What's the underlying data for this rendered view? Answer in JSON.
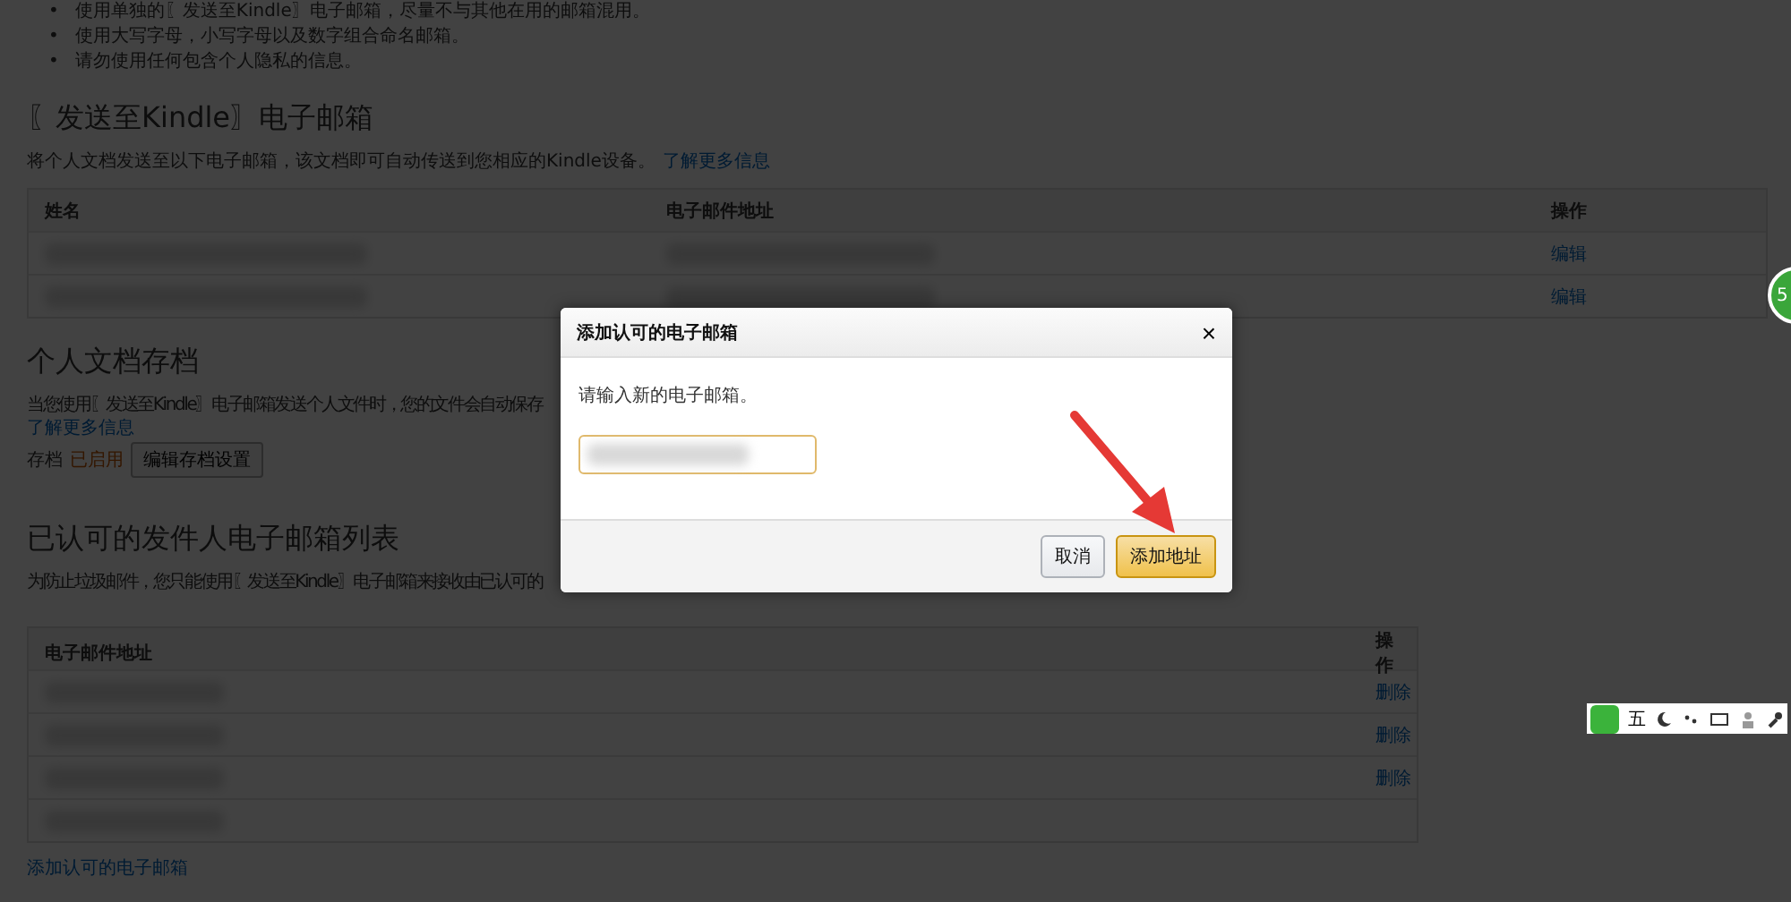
{
  "guideline_marker": "•",
  "guidelines": [
    "使用单独的〖发送至Kindle〗电子邮箱，尽量不与其他在用的邮箱混用。",
    "使用大写字母，小写字母以及数字组合命名邮箱。",
    "请勿使用任何包含个人隐私的信息。"
  ],
  "kindle_section": {
    "title": "〖发送至Kindle〗电子邮箱",
    "description": "将个人文档发送至以下电子邮箱，该文档即可自动传送到您相应的Kindle设备。",
    "link": "了解更多信息",
    "columns": [
      "姓名",
      "电子邮件地址",
      "操作"
    ],
    "rows": [
      {
        "action": "编辑"
      },
      {
        "action": "编辑"
      }
    ]
  },
  "archive_section": {
    "title": "个人文档存档",
    "description": "当您使用〖发送至Kindle〗电子邮箱发送个人文件时，您的文件会自动保存",
    "link": "了解更多信息",
    "label": "存档",
    "status": "已启用",
    "button": "编辑存档设置"
  },
  "approved_section": {
    "title": "已认可的发件人电子邮箱列表",
    "description": "为防止垃圾邮件，您只能使用〖发送至Kindle〗电子邮箱来接收由已认可的",
    "columns": [
      "电子邮件地址",
      "操作"
    ],
    "rows": [
      {
        "action": "删除"
      },
      {
        "action": "删除"
      },
      {
        "action": "删除"
      },
      {
        "action": ""
      }
    ],
    "add_link": "添加认可的电子邮箱"
  },
  "dialog": {
    "title": "添加认可的电子邮箱",
    "close": "×",
    "prompt": "请输入新的电子邮箱。",
    "buttons": [
      {
        "label": "取消",
        "kind": "secondary"
      },
      {
        "label": "添加地址",
        "kind": "primary"
      }
    ]
  },
  "side_badge": "5",
  "ime_toolbar": {
    "mode": "五"
  }
}
